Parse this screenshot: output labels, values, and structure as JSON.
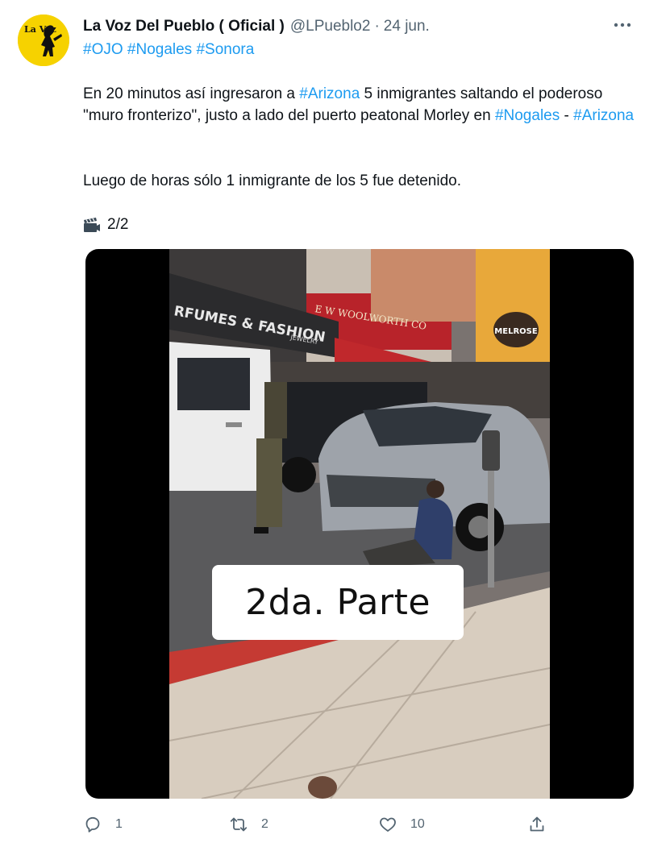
{
  "author": {
    "display_name": "La Voz Del Pueblo ( Oficial )",
    "handle": "@LPueblo2",
    "separator": "·",
    "date": "24 jun.",
    "avatar_text": "La Voz"
  },
  "tweet": {
    "hashtags": [
      "#OJO",
      "#Nogales",
      "#Sonora"
    ],
    "line1_a": "En 20 minutos así ingresaron a ",
    "line1_link": "#Arizona",
    "line1_b": " 5 inmigrantes saltando el poderoso \"muro fronterizo\", justo a lado del puerto peatonal Morley en ",
    "line3_link1": "#Nogales",
    "line3_sep": " - ",
    "line3_link2": "#Arizona",
    "paragraph2": "Luego de horas sólo 1 inmigrante de los 5 fue detenido.",
    "counter_icon": "clapperboard-icon",
    "counter": "2/2"
  },
  "media": {
    "caption": "2da. Parte",
    "sign_left": "RFUMES & FASHION",
    "sign_left_sub": "JEWELRY",
    "sign_mid": "E W WOOLWORTH CO",
    "sign_right": "MELROSE"
  },
  "actions": {
    "reply_count": "1",
    "retweet_count": "2",
    "like_count": "10"
  },
  "colors": {
    "link": "#1d9bf0",
    "secondary_text": "#536471",
    "avatar_bg": "#f6d200"
  }
}
